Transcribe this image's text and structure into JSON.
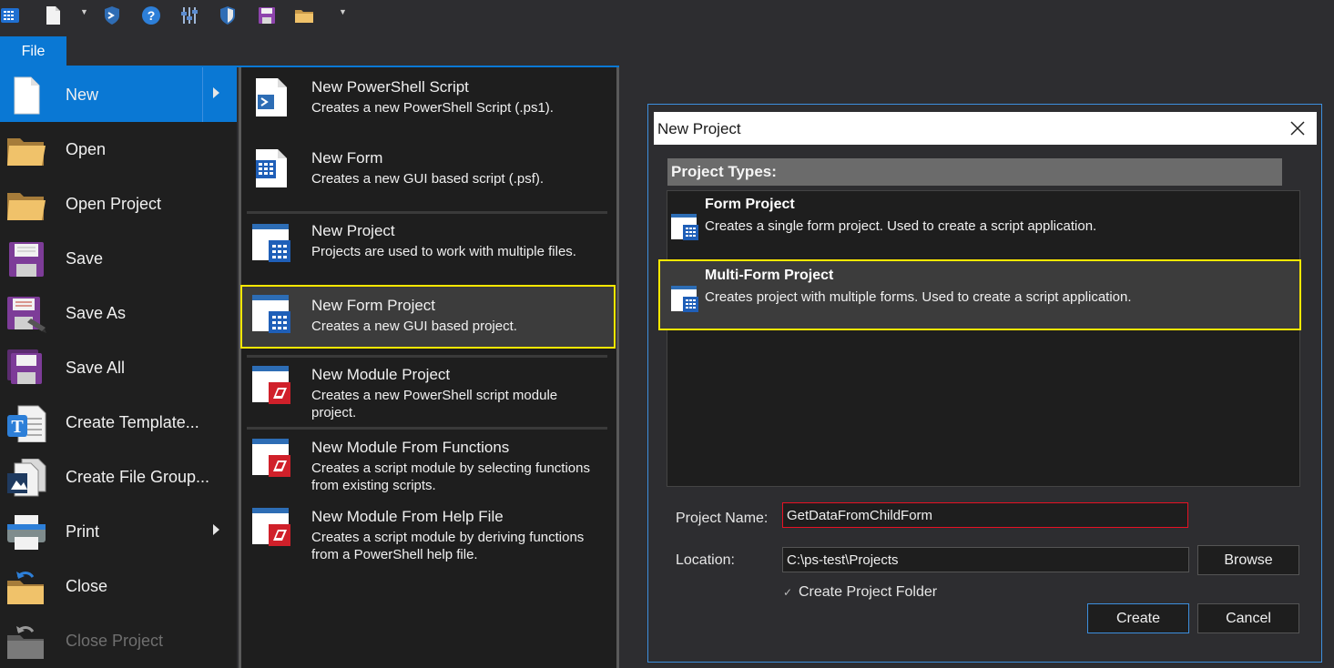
{
  "menu": {
    "file_tab": "File",
    "items": [
      {
        "label": "New",
        "icon": "new-file-icon",
        "submenu": true,
        "active": true
      },
      {
        "label": "Open",
        "icon": "folder-icon"
      },
      {
        "label": "Open Project",
        "icon": "folder-icon"
      },
      {
        "label": "Save",
        "icon": "floppy-disk-icon"
      },
      {
        "label": "Save As",
        "icon": "floppy-disk-pen-icon"
      },
      {
        "label": "Save All",
        "icon": "floppy-disks-icon"
      },
      {
        "label": "Create Template...",
        "icon": "template-icon"
      },
      {
        "label": "Create File Group...",
        "icon": "file-group-icon"
      },
      {
        "label": "Print",
        "icon": "printer-icon",
        "submenu": true
      },
      {
        "label": "Close",
        "icon": "close-folder-icon"
      },
      {
        "label": "Close Project",
        "icon": "close-project-icon",
        "disabled": true
      }
    ]
  },
  "submenu": {
    "items": [
      {
        "title": "New PowerShell Script",
        "desc": "Creates a new PowerShell Script (.ps1).",
        "icon": "powershell-script-icon"
      },
      {
        "title": "New Form",
        "desc": "Creates a new GUI based script (.psf).",
        "icon": "form-icon"
      },
      {
        "title": "New Project",
        "desc": "Projects are used to work with multiple files.",
        "icon": "project-icon"
      },
      {
        "title": "New Form Project",
        "desc": "Creates a new GUI based project.",
        "icon": "form-project-icon",
        "highlighted": true
      },
      {
        "title": "New Module Project",
        "desc": "Creates a new PowerShell script module project.",
        "icon": "module-project-icon"
      },
      {
        "title": "New Module From Functions",
        "desc": "Creates a script module by selecting functions from existing scripts.",
        "icon": "module-functions-icon"
      },
      {
        "title": "New Module From Help File",
        "desc": "Creates a script module by deriving functions from a PowerShell help file.",
        "icon": "module-help-icon"
      }
    ]
  },
  "dialog": {
    "title": "New Project",
    "project_types_header": "Project Types:",
    "project_types": [
      {
        "name": "Form Project",
        "desc": "Creates a single form project. Used to create a script application."
      },
      {
        "name": "Multi-Form Project",
        "desc": "Creates project with multiple forms. Used to create a script application.",
        "selected": true
      }
    ],
    "project_name_label": "Project Name:",
    "project_name_value": "GetDataFromChildForm",
    "location_label": "Location:",
    "location_value": "C:\\ps-test\\Projects",
    "browse_label": "Browse",
    "create_folder_label": "Create Project Folder",
    "create_label": "Create",
    "cancel_label": "Cancel"
  },
  "colors": {
    "accent": "#0a78d4",
    "highlight": "#ffe800",
    "error_border": "#e81123"
  }
}
